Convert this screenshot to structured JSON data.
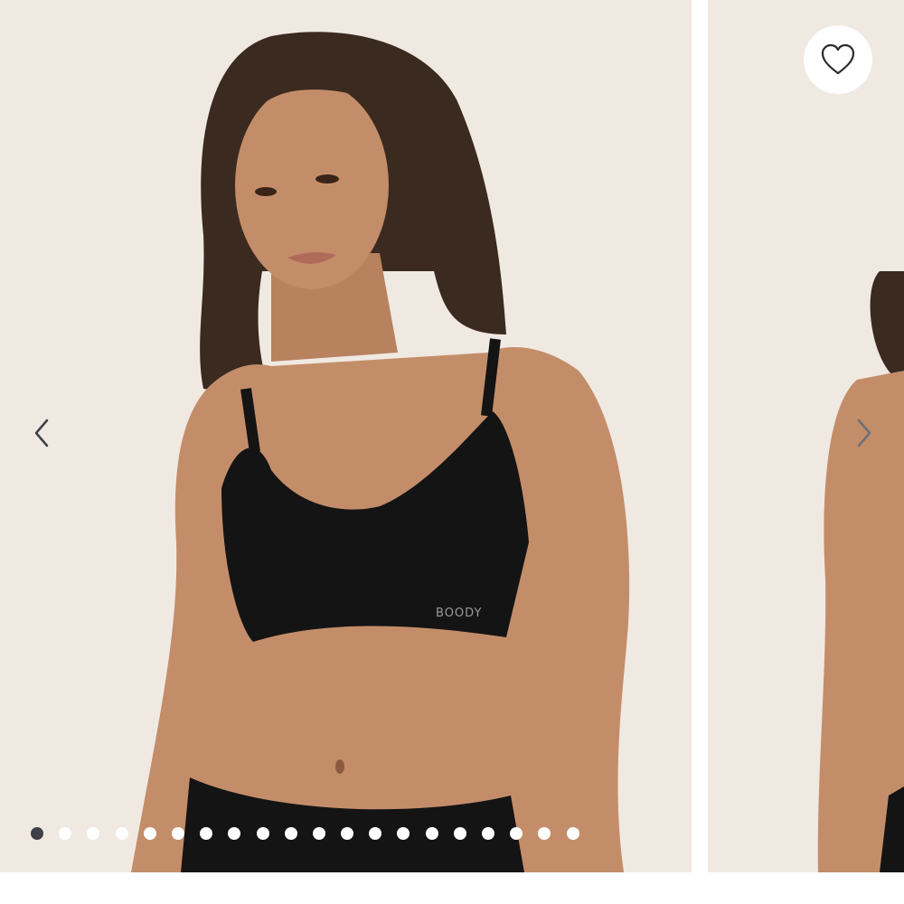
{
  "gallery": {
    "slide_count": 20,
    "active_index": 0,
    "background_color": "#efe9e2",
    "brand_mark": "BOODY",
    "icons": {
      "prev": "chevron-left-icon",
      "next": "chevron-right-icon",
      "wishlist": "heart-outline-icon"
    }
  }
}
